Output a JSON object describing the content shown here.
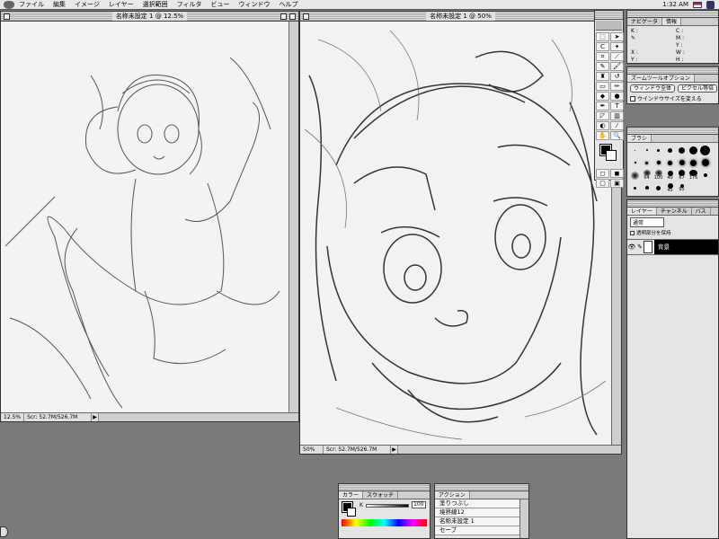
{
  "menubar": {
    "items": [
      "ファイル",
      "編集",
      "イメージ",
      "レイヤー",
      "選択範囲",
      "フィルタ",
      "ビュー",
      "ウィンドウ",
      "ヘルプ"
    ],
    "clock": "1:32 AM"
  },
  "window1": {
    "title": "名称未設定 1 @ 12.5%",
    "zoom": "12.5%",
    "doc_size": "Scr: 52.7M/526.7M"
  },
  "window2": {
    "title": "名称未設定 1 @ 50%",
    "zoom": "50%",
    "doc_size": "Scr: 52.7M/526.7M"
  },
  "navigator": {
    "tabs": [
      "ナビゲータ",
      "情報"
    ],
    "labels": {
      "c": "C :",
      "m": "M :",
      "y": "Y :",
      "k": "K :",
      "x": "X :",
      "yy": "Y :",
      "w": "W :",
      "h": "H :"
    }
  },
  "zoom_options": {
    "tab": "ズームツールオプション",
    "btn_fit": "ウィンドウ全体",
    "btn_actual": "ピクセル等倍",
    "checkbox_label": "ウインドウサイズを変える"
  },
  "brushes": {
    "tab": "ブラシ",
    "labels": [
      "64",
      "100",
      "40",
      "67",
      "176",
      "45",
      "95"
    ]
  },
  "layers": {
    "tabs": [
      "レイヤー",
      "チャンネル",
      "パス"
    ],
    "mode": "通常",
    "preserve": "透明部分を保持",
    "layer_name": "背景"
  },
  "color_palette": {
    "tabs": [
      "カラー",
      "スウォッチ"
    ],
    "channel": "K",
    "value": "100"
  },
  "actions": {
    "tab": "アクション",
    "items": [
      "塗りつぶし",
      "境界線12",
      "名称未設定 1",
      "セーブ"
    ]
  }
}
